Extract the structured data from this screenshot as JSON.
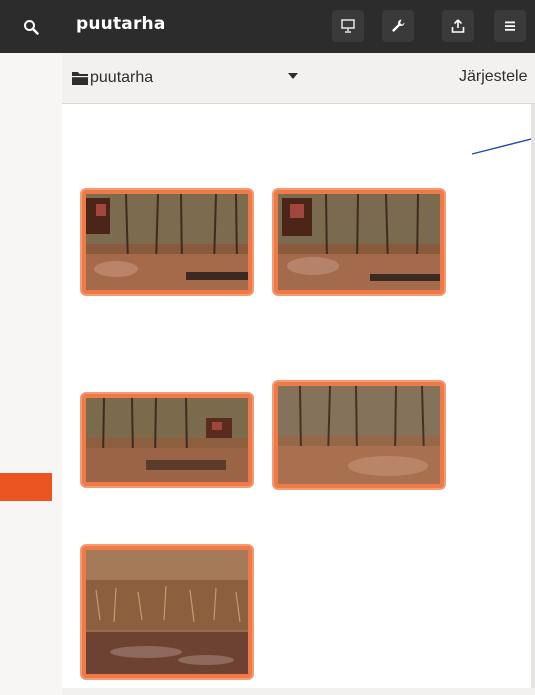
{
  "header": {
    "title": "puutarha",
    "buttons": [
      {
        "icon": "search-icon"
      },
      {
        "icon": "slideshow-icon"
      },
      {
        "icon": "wrench-icon"
      },
      {
        "icon": "share-icon"
      },
      {
        "icon": "hamburger-menu-icon"
      }
    ]
  },
  "toolbar": {
    "folder_icon": "folder-icon",
    "folder_label": "puutarha",
    "dropdown_icon": "chevron-down-icon",
    "sort_label": "Järjestele"
  },
  "colors": {
    "header_bg": "#2c2c2c",
    "accent": "#e95420",
    "selection_border": "#ef7a48",
    "background": "#f2f1f0",
    "callout_line": "#1f4fa8"
  },
  "photos": [
    {
      "selected": true,
      "scene": "forest-with-cabin"
    },
    {
      "selected": true,
      "scene": "forest-with-cabin"
    },
    {
      "selected": true,
      "scene": "forest-clearing"
    },
    {
      "selected": true,
      "scene": "forest-edge"
    },
    {
      "selected": true,
      "scene": "stream-with-grass"
    }
  ]
}
